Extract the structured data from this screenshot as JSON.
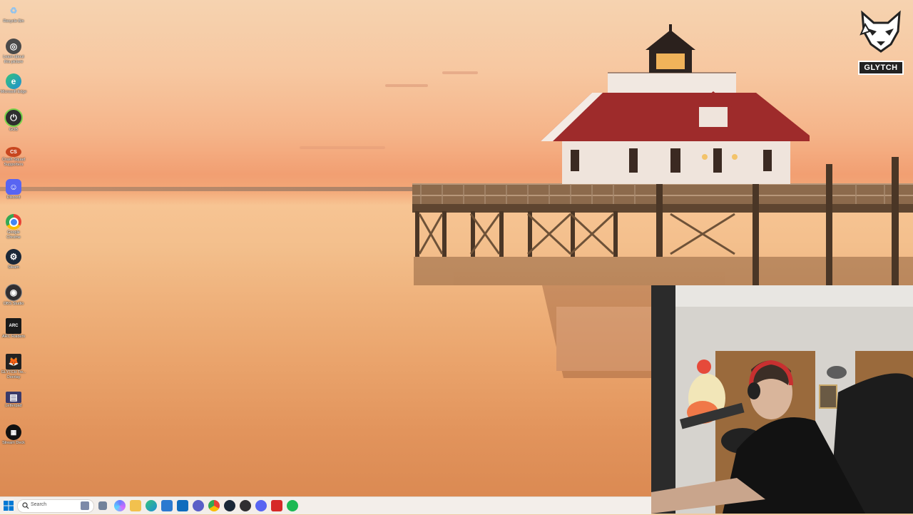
{
  "desktop": {
    "icons": [
      {
        "label": "Recycle Bin",
        "icon": "recycle-bin-icon",
        "color": "#6fa8dc"
      },
      {
        "label": "Learn about this picture",
        "icon": "camera-icon",
        "color": "#4a4a4a"
      },
      {
        "label": "Microsoft Edge",
        "icon": "edge-icon",
        "color": "#1e8fd6"
      },
      {
        "label": "GOB",
        "icon": "power-icon",
        "color": "#2e2e2e"
      },
      {
        "label": "Crash Squad Supporters",
        "icon": "game-icon",
        "color": "#c8461f"
      },
      {
        "label": "Discord",
        "icon": "discord-icon",
        "color": "#5865f2"
      },
      {
        "label": "Google Chrome",
        "icon": "chrome-icon",
        "color": "#e94235"
      },
      {
        "label": "Steam",
        "icon": "steam-icon",
        "color": "#1b2838"
      },
      {
        "label": "OBS Studio",
        "icon": "obs-icon",
        "color": "#302e31"
      },
      {
        "label": "ARC Raiders",
        "icon": "arc-raiders-icon",
        "color": "#1a1a1a"
      },
      {
        "label": "GLYTCH Tw... Overlay",
        "icon": "glytch-icon",
        "color": "#222222"
      },
      {
        "label": "Letterpad",
        "icon": "letterpad-icon",
        "color": "#3a3a6a"
      },
      {
        "label": "Stream Deck",
        "icon": "stream-deck-icon",
        "color": "#111111"
      }
    ]
  },
  "overlay": {
    "brand": "GLYTCH"
  },
  "taskbar": {
    "search_placeholder": "Search",
    "apps": [
      {
        "icon": "task-view-icon",
        "color": "#5a6e8c"
      },
      {
        "icon": "copilot-icon",
        "color": "#6b7cff"
      },
      {
        "icon": "edge-icon",
        "color": "#1e8fd6"
      },
      {
        "icon": "file-explorer-icon",
        "color": "#f2c14e"
      },
      {
        "icon": "store-icon",
        "color": "#2b79d0"
      },
      {
        "icon": "outlook-icon",
        "color": "#0f6cbd"
      },
      {
        "icon": "teams-icon",
        "color": "#5b5fc7"
      },
      {
        "icon": "chrome-icon",
        "color": "#e94235"
      },
      {
        "icon": "steam-icon",
        "color": "#1b2838"
      },
      {
        "icon": "obs-icon",
        "color": "#302e31"
      },
      {
        "icon": "discord-icon",
        "color": "#5865f2"
      },
      {
        "icon": "red-app-icon",
        "color": "#d62828"
      },
      {
        "icon": "spotify-icon",
        "color": "#1db954"
      }
    ]
  }
}
